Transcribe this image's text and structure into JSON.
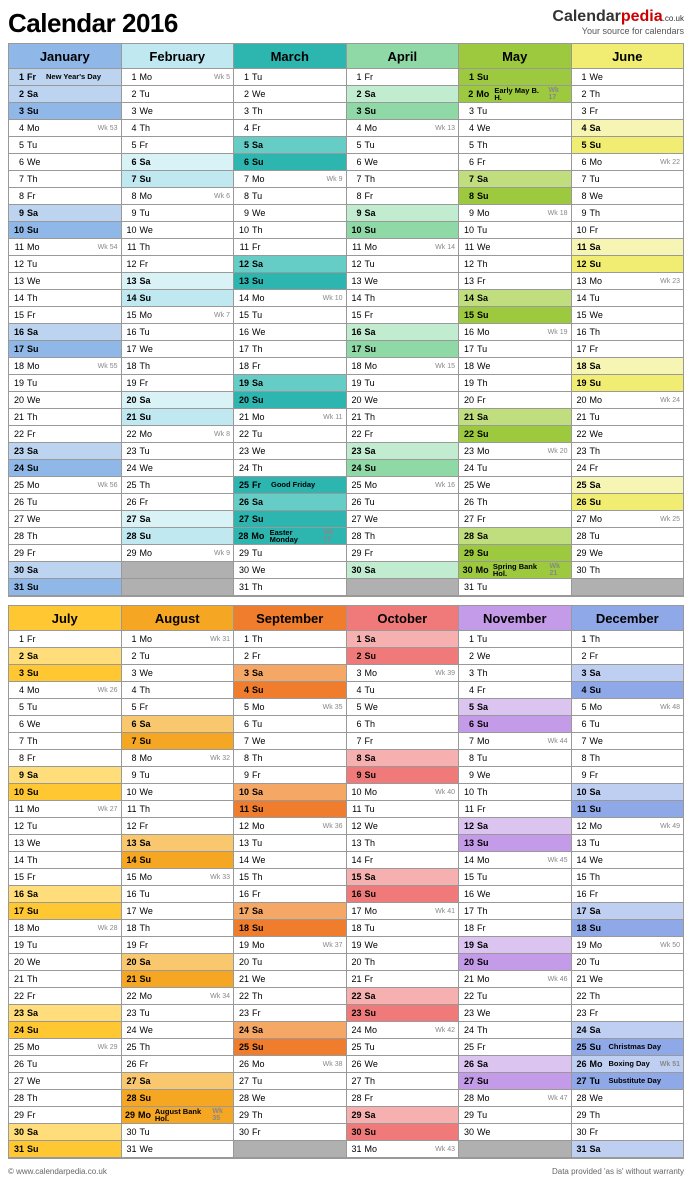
{
  "title": "Calendar 2016",
  "brand_name": "Calendarpedia",
  "brand_tag": "Your source for calendars",
  "brand_tld": ".co.uk",
  "footer_left": "© www.calendarpedia.co.uk",
  "footer_right": "Data provided 'as is' without warranty",
  "dow": [
    "Mo",
    "Tu",
    "We",
    "Th",
    "Fr",
    "Sa",
    "Su"
  ],
  "months": [
    {
      "name": "January",
      "days": 31,
      "start": 4,
      "firstWk": 53,
      "h": {
        "1": "New Year's Day"
      },
      "pal": {
        "mh": "#8fb8e8",
        "l": "#bcd4f0",
        "d": "#8fb8e8"
      }
    },
    {
      "name": "February",
      "days": 29,
      "start": 0,
      "firstWk": 5,
      "h": {},
      "pal": {
        "mh": "#bfe8f0",
        "l": "#d9f2f6",
        "d": "#bfe8f0"
      }
    },
    {
      "name": "March",
      "days": 31,
      "start": 1,
      "firstWk": 9,
      "h": {
        "25": "Good Friday",
        "28": "Easter Monday"
      },
      "pal": {
        "mh": "#2db5b0",
        "l": "#66ccc6",
        "d": "#2db5b0"
      },
      "extraWe": {
        "25": true,
        "28": true
      }
    },
    {
      "name": "April",
      "days": 30,
      "start": 4,
      "firstWk": 13,
      "h": {},
      "pal": {
        "mh": "#8ed9a6",
        "l": "#c1ecd0",
        "d": "#8ed9a6"
      }
    },
    {
      "name": "May",
      "days": 31,
      "start": 6,
      "firstWk": 17,
      "h": {
        "2": "Early May B. H.",
        "30": "Spring Bank Hol."
      },
      "pal": {
        "mh": "#9cc93e",
        "l": "#c1de7e",
        "d": "#9cc93e"
      },
      "extraWe": {
        "2": true,
        "30": true
      }
    },
    {
      "name": "June",
      "days": 30,
      "start": 2,
      "firstWk": 22,
      "h": {},
      "pal": {
        "mh": "#f0ed72",
        "l": "#f7f5b3",
        "d": "#f0ed72"
      }
    },
    {
      "name": "July",
      "days": 31,
      "start": 4,
      "firstWk": 26,
      "h": {},
      "pal": {
        "mh": "#ffc833",
        "l": "#ffdd7a",
        "d": "#ffc833"
      }
    },
    {
      "name": "August",
      "days": 31,
      "start": 0,
      "firstWk": 31,
      "h": {
        "29": "August Bank Hol."
      },
      "pal": {
        "mh": "#f5a623",
        "l": "#f9c76e",
        "d": "#f5a623"
      },
      "extraWe": {
        "29": true
      }
    },
    {
      "name": "September",
      "days": 30,
      "start": 3,
      "firstWk": 35,
      "h": {},
      "pal": {
        "mh": "#f07d2e",
        "l": "#f5a866",
        "d": "#f07d2e"
      }
    },
    {
      "name": "October",
      "days": 31,
      "start": 5,
      "firstWk": 39,
      "h": {},
      "pal": {
        "mh": "#f07a7a",
        "l": "#f7b0b0",
        "d": "#f07a7a"
      }
    },
    {
      "name": "November",
      "days": 30,
      "start": 1,
      "firstWk": 44,
      "h": {},
      "pal": {
        "mh": "#c49be8",
        "l": "#dcc4f0",
        "d": "#c49be8"
      }
    },
    {
      "name": "December",
      "days": 31,
      "start": 3,
      "firstWk": 48,
      "h": {
        "25": "Christmas Day",
        "26": "Boxing Day",
        "27": "Substitute Day"
      },
      "pal": {
        "mh": "#8fa8e8",
        "l": "#bfcff2",
        "d": "#8fa8e8"
      },
      "extraWe": {
        "27": true
      }
    }
  ]
}
